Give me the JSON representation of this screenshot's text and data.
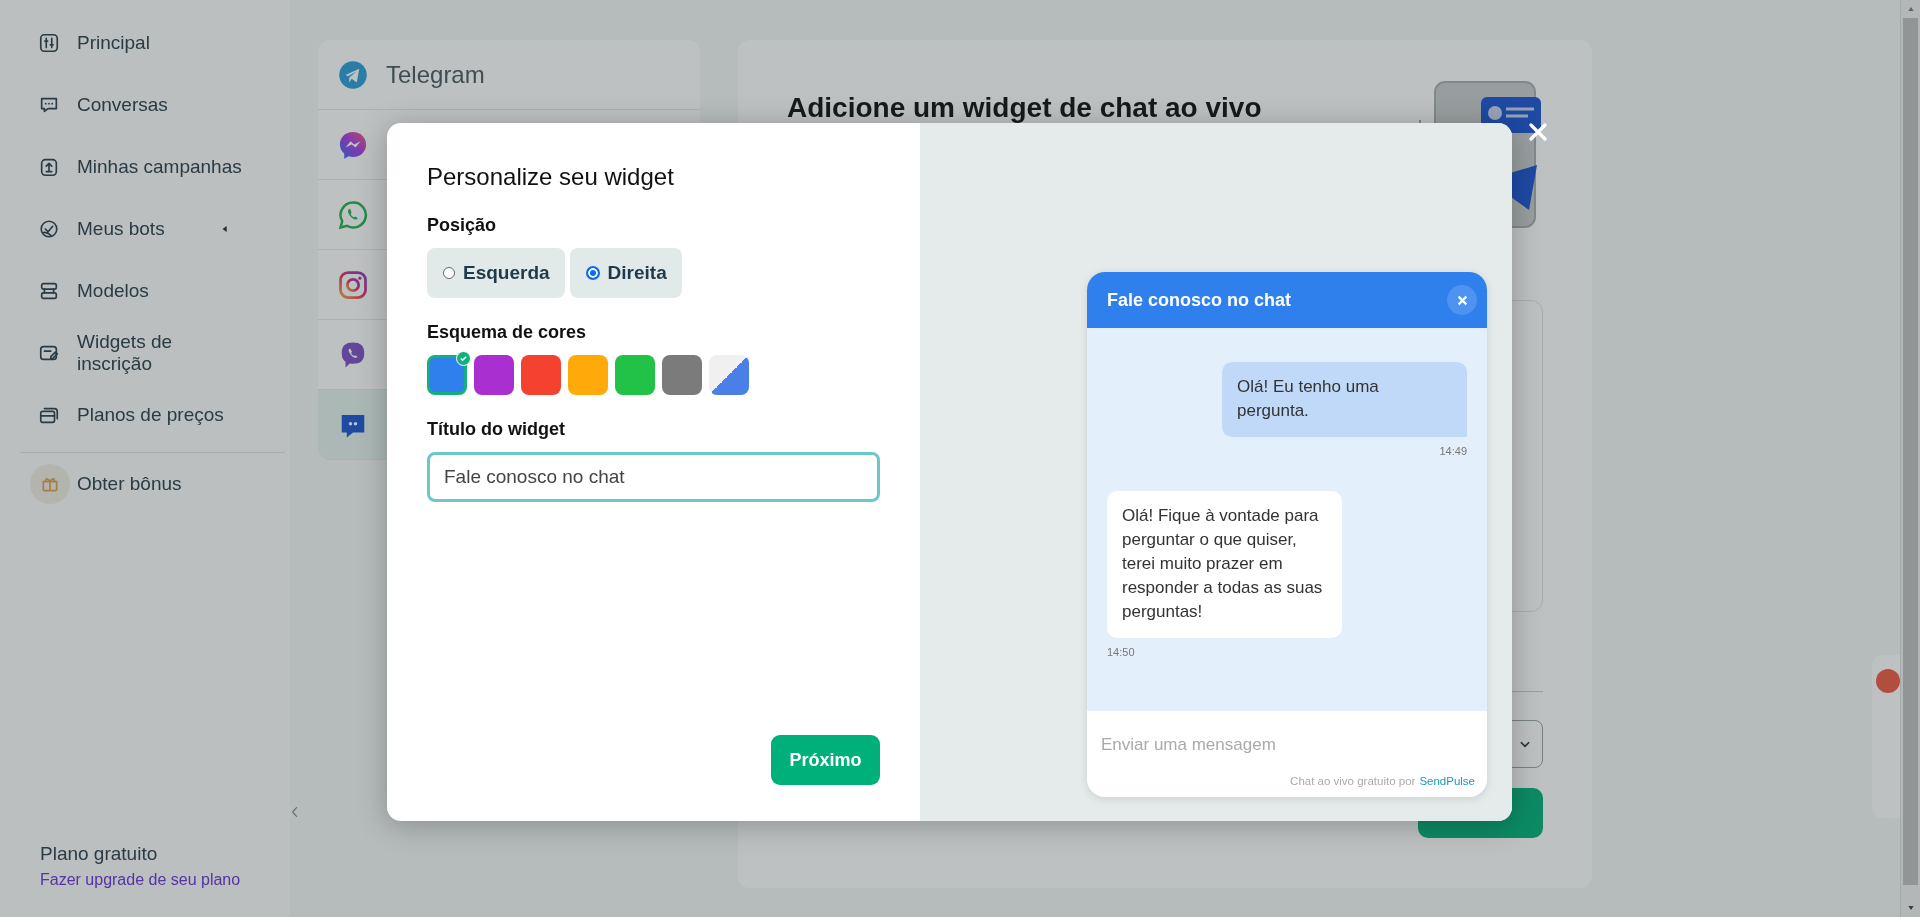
{
  "sidebar": {
    "items": [
      {
        "label": "Principal",
        "kind": "sliders",
        "has_submenu": false
      },
      {
        "label": "Conversas",
        "kind": "chat",
        "has_submenu": false
      },
      {
        "label": "Minhas campanhas",
        "kind": "upload",
        "has_submenu": false
      },
      {
        "label": "Meus bots",
        "kind": "bot",
        "has_submenu": true
      },
      {
        "label": "Modelos",
        "kind": "stack",
        "has_submenu": false
      },
      {
        "label": "Widgets de inscrição",
        "kind": "form",
        "has_submenu": false
      },
      {
        "label": "Planos de preços",
        "kind": "cards",
        "has_submenu": false
      }
    ],
    "bonus": {
      "label": "Obter bônus"
    },
    "plan": {
      "name": "Plano gratuito",
      "upgrade_link": "Fazer upgrade de seu plano"
    }
  },
  "page": {
    "channels": [
      {
        "label": "Telegram",
        "kind": "plane",
        "selected": false
      },
      {
        "kind": "messenger",
        "selected": false
      },
      {
        "kind": "phone",
        "selected": false
      },
      {
        "kind": "camera",
        "selected": false
      },
      {
        "kind": "viber",
        "selected": false
      },
      {
        "kind": "livechat",
        "selected": true
      }
    ],
    "panel": {
      "title": "Adicione um widget de chat ao vivo"
    }
  },
  "modal": {
    "title": "Personalize seu widget",
    "position": {
      "label": "Posição",
      "options": [
        {
          "label": "Esquerda",
          "selected": false
        },
        {
          "label": "Direita",
          "selected": true
        }
      ]
    },
    "color_scheme": {
      "label": "Esquema de cores",
      "swatches": [
        {
          "kind": "solid",
          "color": "#2f80ed",
          "selected": true
        },
        {
          "kind": "solid",
          "color": "#a92fd1",
          "selected": false
        },
        {
          "kind": "solid",
          "color": "#f44130",
          "selected": false
        },
        {
          "kind": "solid",
          "color": "#ffa90a",
          "selected": false
        },
        {
          "kind": "solid",
          "color": "#22c147",
          "selected": false
        },
        {
          "kind": "solid",
          "color": "#7b7b7b",
          "selected": false
        },
        {
          "kind": "split",
          "color": "#4a7fe8",
          "selected": false
        }
      ]
    },
    "widget_title": {
      "label": "Título do widget",
      "value": "Fale conosco no chat"
    },
    "next_button": "Próximo",
    "preview": {
      "header_title": "Fale conosco no chat",
      "messages": [
        {
          "kind": "outgoing",
          "text": "Olá! Eu tenho uma pergunta.",
          "time": "14:49"
        },
        {
          "kind": "incoming",
          "text": "Olá! Fique à vontade para perguntar o que quiser, terei muito prazer em responder a todas as suas perguntas!",
          "time": "14:50"
        }
      ],
      "input_placeholder": "Enviar uma mensagem",
      "footer_text": "Chat ao vivo gratuito por",
      "footer_link": "SendPulse"
    }
  }
}
